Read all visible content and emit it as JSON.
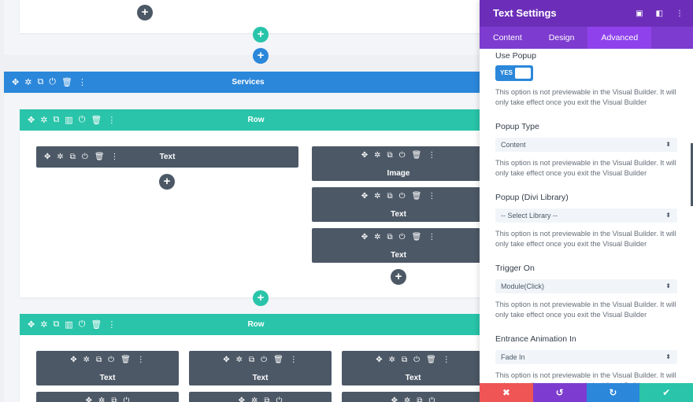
{
  "icons": {
    "move": "✥",
    "settings": "✲",
    "duplicate": "⧉",
    "columns": "▥",
    "power": "⏻",
    "delete": "🗑",
    "more": "⋮",
    "add": "+",
    "fullscreen": "▣",
    "split": "◧",
    "close": "✖",
    "undo": "↺",
    "redo": "↻",
    "save": "✔",
    "caret": "⬍"
  },
  "builder": {
    "section_label": "Services",
    "row1_label": "Row",
    "row2_label": "Row",
    "modules": {
      "left_text": "Text",
      "image": "Image",
      "text_a": "Text",
      "text_b": "Text",
      "grid_1": "Text",
      "grid_2": "Text",
      "grid_3": "Text"
    }
  },
  "panel": {
    "title": "Text Settings",
    "tabs": [
      "Content",
      "Design",
      "Advanced"
    ],
    "active_tab": "Advanced",
    "fields": {
      "use_popup": {
        "label": "Use Popup",
        "value": "YES",
        "note": "This option is not previewable in the Visual Builder. It will only take effect once you exit the Visual Builder"
      },
      "popup_type": {
        "label": "Popup Type",
        "value": "Content",
        "note": "This option is not previewable in the Visual Builder. It will only take effect once you exit the Visual Builder"
      },
      "popup_library": {
        "label": "Popup (Divi Library)",
        "value": "-- Select Library --",
        "note": "This option is not previewable in the Visual Builder. It will only take effect once you exit the Visual Builder"
      },
      "trigger_on": {
        "label": "Trigger On",
        "value": "Module(Click)",
        "note": "This option is not previewable in the Visual Builder. It will only take effect once you exit the Visual Builder"
      },
      "entrance_animation": {
        "label": "Entrance Animation In",
        "value": "Fade In",
        "note": "This option is not previewable in the Visual Builder. It will only take effect once you exit the Visual Builder"
      }
    }
  },
  "colors": {
    "purple_header": "#6c2eb9",
    "purple_tabs": "#7d3bcf",
    "section_blue": "#2b87da",
    "row_teal": "#29c4a9",
    "module_gray": "#4c5866",
    "discard_red": "#ef5555"
  }
}
